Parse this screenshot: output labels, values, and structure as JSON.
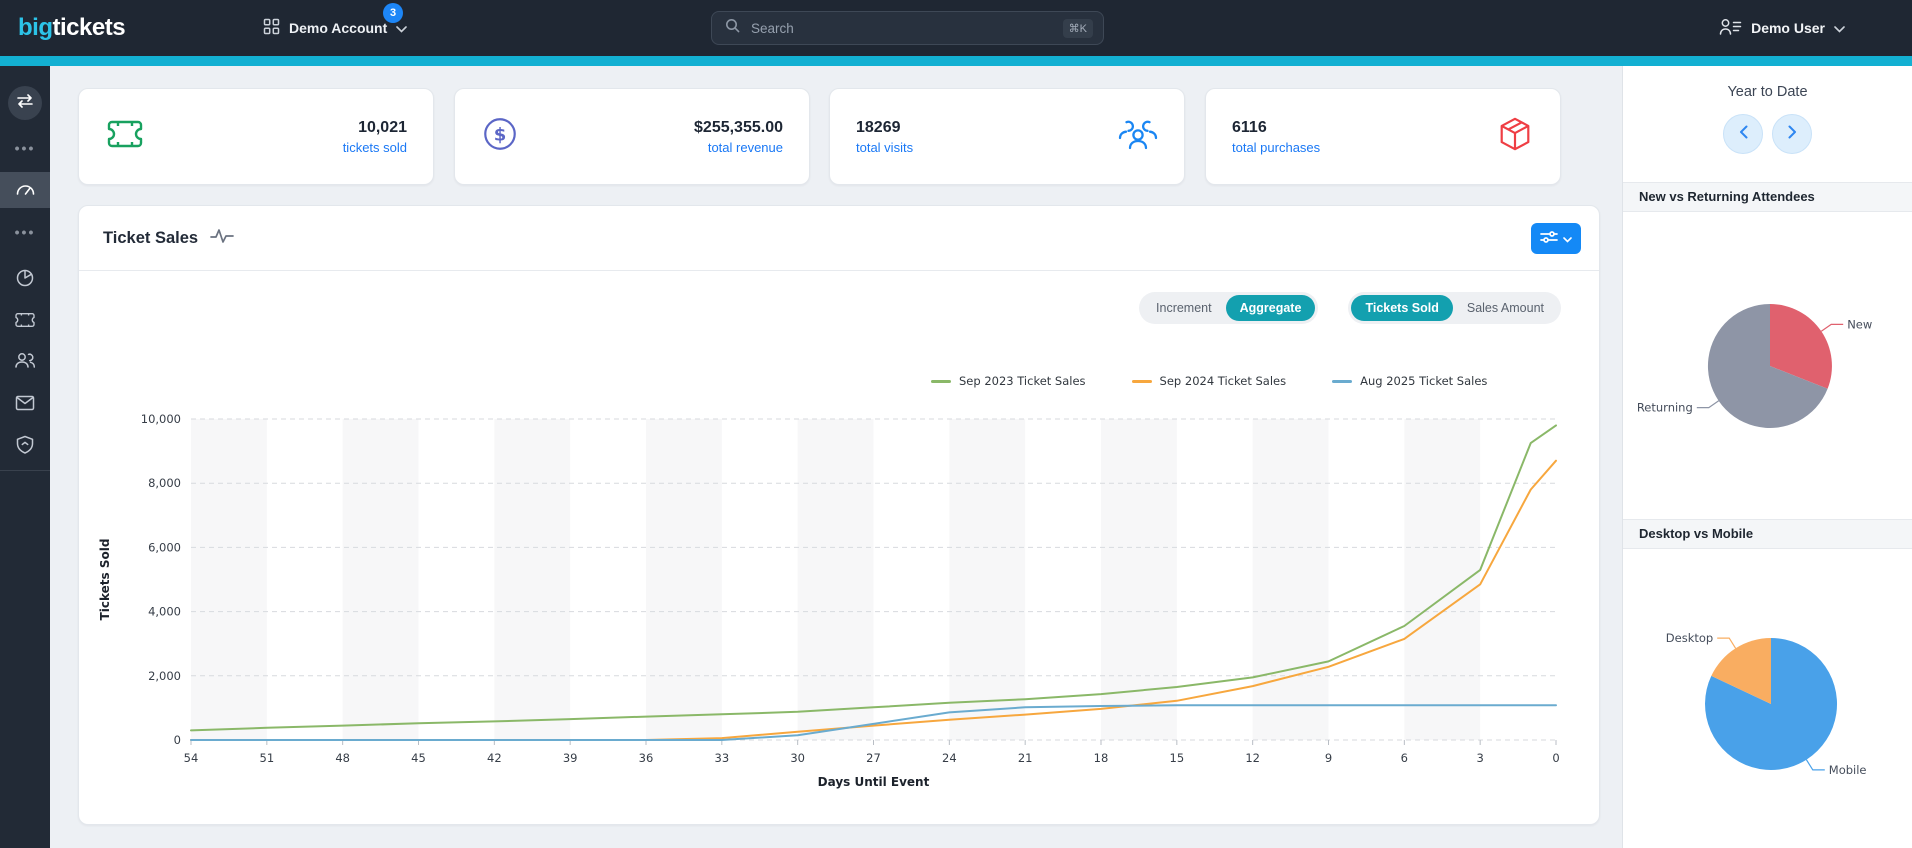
{
  "header": {
    "logo_part1": "big",
    "logo_part2": "tickets",
    "account": {
      "label": "Demo Account",
      "badge": "3"
    },
    "search": {
      "placeholder": "Search",
      "shortcut": "⌘K"
    },
    "user": {
      "label": "Demo User"
    }
  },
  "sidebar": {
    "items": [
      {
        "id": "collapse",
        "icon": "swap-arrows-icon"
      },
      {
        "id": "more-top",
        "icon": "ellipsis-icon"
      },
      {
        "id": "dashboard",
        "icon": "gauge-icon",
        "active": true
      },
      {
        "id": "more-mid",
        "icon": "ellipsis-icon"
      },
      {
        "id": "reports",
        "icon": "pie-chart-icon"
      },
      {
        "id": "tickets",
        "icon": "ticket-icon"
      },
      {
        "id": "attendees",
        "icon": "users-icon"
      },
      {
        "id": "messages",
        "icon": "mail-icon"
      },
      {
        "id": "security",
        "icon": "shield-icon"
      }
    ]
  },
  "stats": [
    {
      "value": "10,021",
      "label": "tickets sold",
      "icon": "ticket-icon",
      "icon_color": "#18a15f"
    },
    {
      "value": "$255,355.00",
      "label": "total revenue",
      "icon": "dollar-circle-icon",
      "icon_color": "#5b66c6"
    },
    {
      "value": "18269",
      "label": "total visits",
      "icon": "users-group-icon",
      "icon_color": "#1a86f3"
    },
    {
      "value": "6116",
      "label": "total purchases",
      "icon": "package-icon",
      "icon_color": "#ef3e44"
    }
  ],
  "ticket_sales_panel": {
    "title": "Ticket Sales",
    "mode_toggle": {
      "options": [
        "Increment",
        "Aggregate"
      ],
      "selected": "Aggregate"
    },
    "metric_toggle": {
      "options": [
        "Tickets Sold",
        "Sales Amount"
      ],
      "selected": "Tickets Sold"
    },
    "selected_pill_color": "#13a0af",
    "settings_button_color": "#1489f6"
  },
  "right_panel": {
    "period_label": "Year to Date"
  },
  "chart_data": [
    {
      "type": "line",
      "title": "Ticket Sales",
      "xlabel": "Days Until Event",
      "ylabel": "Tickets Sold",
      "x_direction": "descending",
      "ylim": [
        0,
        10000
      ],
      "yticks": [
        0,
        2000,
        4000,
        6000,
        8000,
        10000
      ],
      "xticks": [
        54,
        51,
        48,
        45,
        42,
        39,
        36,
        33,
        30,
        27,
        24,
        21,
        18,
        15,
        12,
        9,
        6,
        3,
        0
      ],
      "grid": "horizontal-dashed",
      "legend_position": "top-right",
      "x": [
        54,
        51,
        48,
        45,
        42,
        39,
        36,
        33,
        30,
        27,
        24,
        21,
        18,
        15,
        12,
        9,
        6,
        3,
        1,
        0
      ],
      "series": [
        {
          "name": "Sep 2023 Ticket Sales",
          "color": "#8ab868",
          "values": [
            300,
            380,
            450,
            520,
            580,
            650,
            730,
            800,
            880,
            1020,
            1160,
            1270,
            1430,
            1650,
            1950,
            2450,
            3550,
            5300,
            9250,
            9800
          ]
        },
        {
          "name": "Sep 2024 Ticket Sales",
          "color": "#f7a73e",
          "values": [
            0,
            0,
            0,
            0,
            0,
            0,
            0,
            60,
            260,
            450,
            630,
            790,
            970,
            1220,
            1680,
            2280,
            3150,
            4850,
            7800,
            8700
          ]
        },
        {
          "name": "Aug 2025 Ticket Sales",
          "color": "#6aabcf",
          "values": [
            0,
            0,
            0,
            0,
            0,
            0,
            0,
            0,
            150,
            500,
            860,
            1020,
            1060,
            1080,
            1080,
            1080,
            1080,
            1080,
            1080,
            1080
          ]
        }
      ]
    },
    {
      "type": "pie",
      "title": "New vs Returning Attendees",
      "slices": [
        {
          "label": "New",
          "value": 31,
          "color": "#e0616e"
        },
        {
          "label": "Returning",
          "value": 69,
          "color": "#8e95a6"
        }
      ]
    },
    {
      "type": "pie",
      "title": "Desktop vs Mobile",
      "slices": [
        {
          "label": "Mobile",
          "value": 82,
          "color": "#49a1e9"
        },
        {
          "label": "Desktop",
          "value": 18,
          "color": "#f9ad61"
        }
      ]
    }
  ]
}
